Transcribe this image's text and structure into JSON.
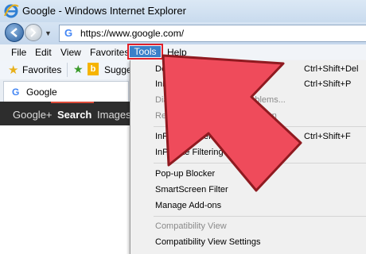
{
  "window": {
    "title": "Google - Windows Internet Explorer"
  },
  "address": {
    "url": "https://www.google.com/",
    "site_icon": "google-g-icon"
  },
  "menubar": {
    "items": [
      "File",
      "Edit",
      "View",
      "Favorites",
      "Tools",
      "Help"
    ],
    "highlighted": "Tools",
    "highlight_color": "#e0202a"
  },
  "favorites_bar": {
    "favorites_label": "Favorites",
    "suggested_label": "Sugges"
  },
  "tab": {
    "label": "Google"
  },
  "google_bar": {
    "links": [
      "Google+",
      "Search",
      "Images"
    ],
    "active": "Search"
  },
  "tools_menu": {
    "items": [
      {
        "label": "Delete Browsing History...",
        "shortcut": "Ctrl+Shift+Del",
        "enabled": true
      },
      {
        "label": "InPrivate Browsing",
        "shortcut": "Ctrl+Shift+P",
        "enabled": true
      },
      {
        "label": "Diagnose Connection Problems...",
        "shortcut": "",
        "enabled": false
      },
      {
        "label": "Reopen Last Browsing Session",
        "shortcut": "",
        "enabled": false
      },
      {
        "label": "InPrivate Filtering",
        "shortcut": "Ctrl+Shift+F",
        "enabled": true
      },
      {
        "label": "InPrivate Filtering Settings",
        "shortcut": "",
        "enabled": true
      },
      {
        "label": "Pop-up Blocker",
        "shortcut": "",
        "enabled": true
      },
      {
        "label": "SmartScreen Filter",
        "shortcut": "",
        "enabled": true
      },
      {
        "label": "Manage Add-ons",
        "shortcut": "",
        "enabled": true
      },
      {
        "label": "Compatibility View",
        "shortcut": "",
        "enabled": false
      },
      {
        "label": "Compatibility View Settings",
        "shortcut": "",
        "enabled": true
      }
    ]
  },
  "annotation": {
    "arrow_color": "#ef4b5b",
    "arrow_outline": "#8f1a20"
  }
}
